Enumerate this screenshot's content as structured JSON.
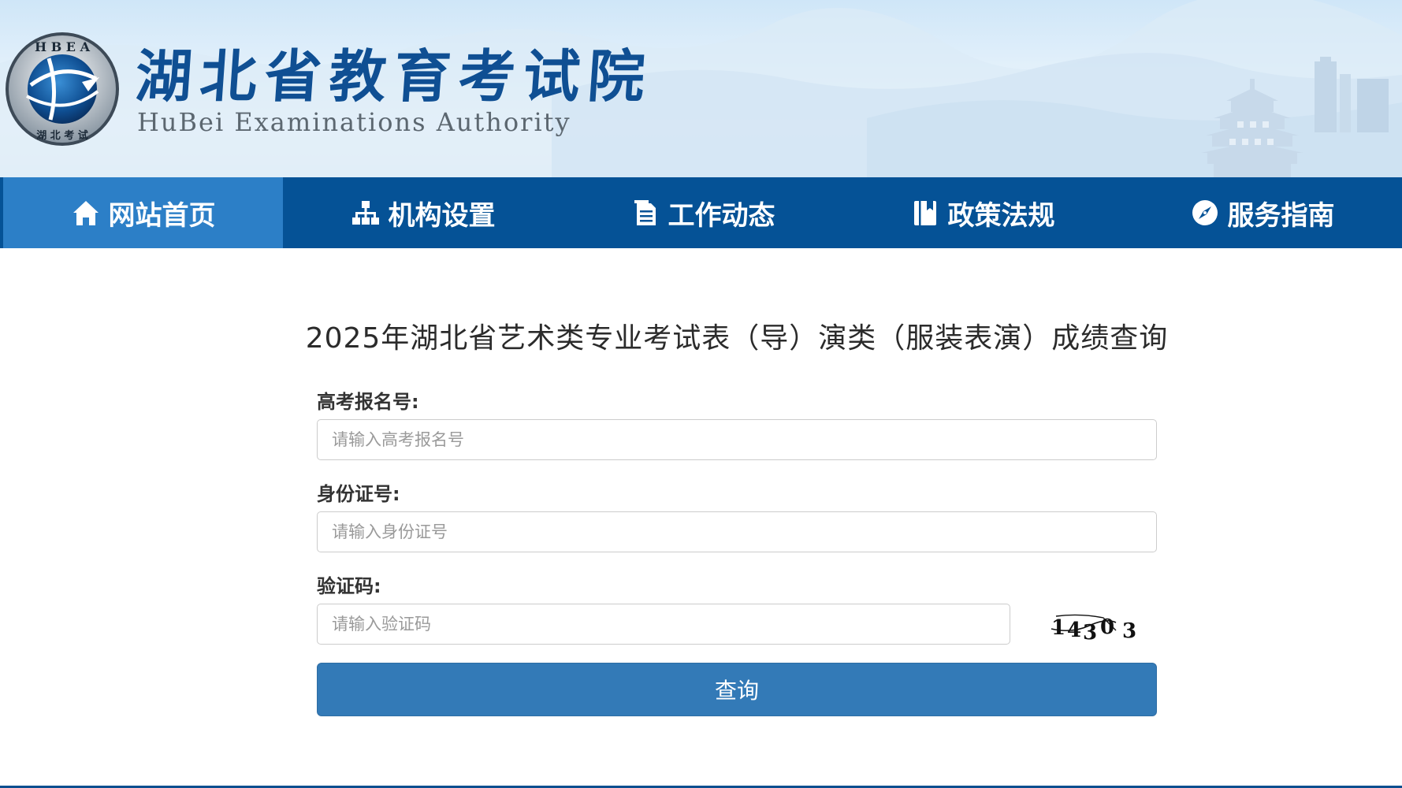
{
  "header": {
    "title": "湖北省教育考试院",
    "subtitle": "HuBei Examinations Authority",
    "logo_text": "HBEA 湖北考试"
  },
  "nav": {
    "items": [
      {
        "label": "网站首页",
        "icon": "home-icon",
        "active": true
      },
      {
        "label": "机构设置",
        "icon": "org-chart-icon",
        "active": false
      },
      {
        "label": "工作动态",
        "icon": "document-icon",
        "active": false
      },
      {
        "label": "政策法规",
        "icon": "book-icon",
        "active": false
      },
      {
        "label": "服务指南",
        "icon": "compass-icon",
        "active": false
      }
    ]
  },
  "form": {
    "title": "2025年湖北省艺术类专业考试表（导）演类（服装表演）成绩查询",
    "fields": {
      "exam_no": {
        "label": "高考报名号:",
        "placeholder": "请输入高考报名号",
        "value": ""
      },
      "id_no": {
        "label": "身份证号:",
        "placeholder": "请输入身份证号",
        "value": ""
      },
      "captcha": {
        "label": "验证码:",
        "placeholder": "请输入验证码",
        "value": "",
        "image_text": "14303"
      }
    },
    "submit_label": "查询"
  },
  "colors": {
    "nav_bg": "#055296",
    "nav_active": "#2c7fc7",
    "button": "#337ab7",
    "title_blue": "#0f4f93"
  }
}
